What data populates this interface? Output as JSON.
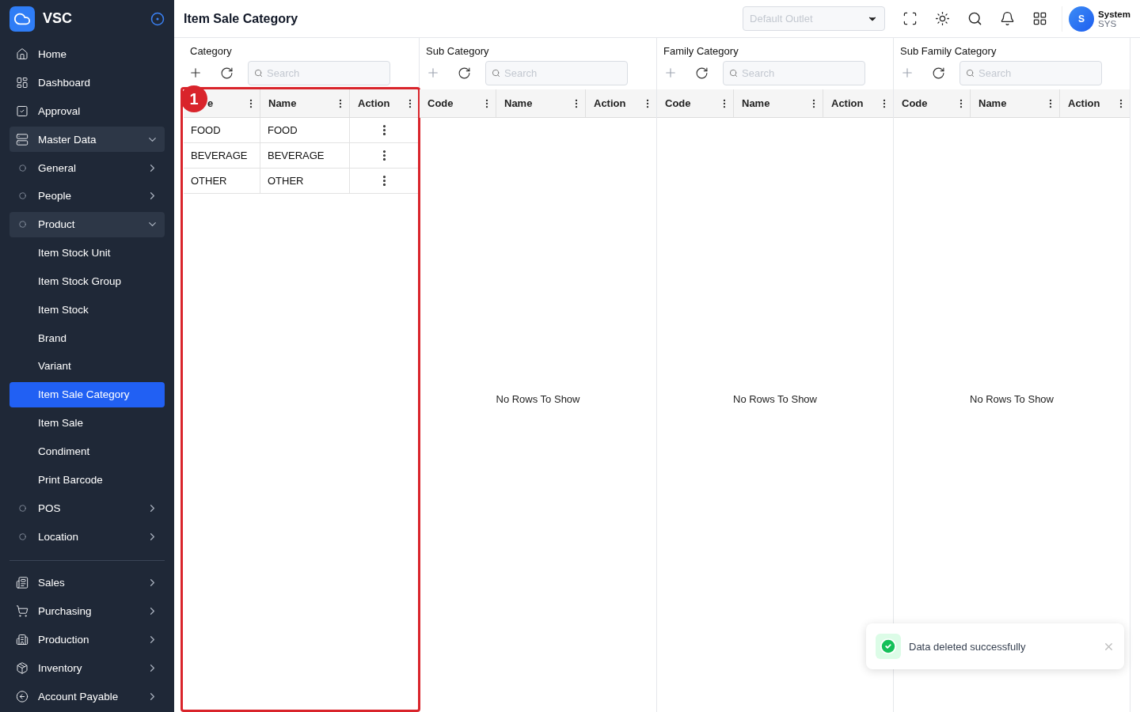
{
  "brand": {
    "name": "VSC"
  },
  "sidebar": {
    "sections": [
      {
        "items": [
          {
            "label": "Home"
          },
          {
            "label": "Dashboard"
          },
          {
            "label": "Approval"
          },
          {
            "label": "Master Data",
            "expanded": true,
            "children": [
              {
                "label": "General",
                "expanded": false
              },
              {
                "label": "People",
                "expanded": false
              },
              {
                "label": "Product",
                "expanded": true,
                "children": [
                  {
                    "label": "Item Stock Unit",
                    "selected": false
                  },
                  {
                    "label": "Item Stock Group",
                    "selected": false
                  },
                  {
                    "label": "Item Stock",
                    "selected": false
                  },
                  {
                    "label": "Brand",
                    "selected": false
                  },
                  {
                    "label": "Variant",
                    "selected": false
                  },
                  {
                    "label": "Item Sale Category",
                    "selected": true
                  },
                  {
                    "label": "Item Sale",
                    "selected": false
                  },
                  {
                    "label": "Condiment",
                    "selected": false
                  },
                  {
                    "label": "Print Barcode",
                    "selected": false
                  }
                ]
              },
              {
                "label": "POS",
                "expanded": false
              },
              {
                "label": "Location",
                "expanded": false
              }
            ]
          }
        ]
      },
      {
        "items": [
          {
            "label": "Sales",
            "expanded": false
          },
          {
            "label": "Purchasing",
            "expanded": false
          },
          {
            "label": "Production",
            "expanded": false
          },
          {
            "label": "Inventory",
            "expanded": false
          },
          {
            "label": "Account Payable",
            "expanded": false
          }
        ]
      }
    ]
  },
  "header": {
    "title": "Item Sale Category",
    "outlet_placeholder": "Default Outlet",
    "user": {
      "initial": "S",
      "name": "System",
      "role": "SYS"
    }
  },
  "panels": [
    {
      "title": "Category",
      "search_placeholder": "Search",
      "annotation": "1",
      "columns": [
        "e",
        "Name",
        "Action"
      ],
      "rows": [
        {
          "code": "FOOD",
          "name": "FOOD"
        },
        {
          "code": "BEVERAGE",
          "name": "BEVERAGE"
        },
        {
          "code": "OTHER",
          "name": "OTHER"
        }
      ]
    },
    {
      "title": "Sub Category",
      "search_placeholder": "Search",
      "columns": [
        "Code",
        "Name",
        "Action"
      ],
      "empty_text": "No Rows To Show"
    },
    {
      "title": "Family Category",
      "search_placeholder": "Search",
      "columns": [
        "Code",
        "Name",
        "Action"
      ],
      "empty_text": "No Rows To Show"
    },
    {
      "title": "Sub Family Category",
      "search_placeholder": "Search",
      "columns": [
        "Code",
        "Name",
        "Action"
      ],
      "empty_text": "No Rows To Show"
    }
  ],
  "toast": {
    "message": "Data deleted successfully"
  }
}
